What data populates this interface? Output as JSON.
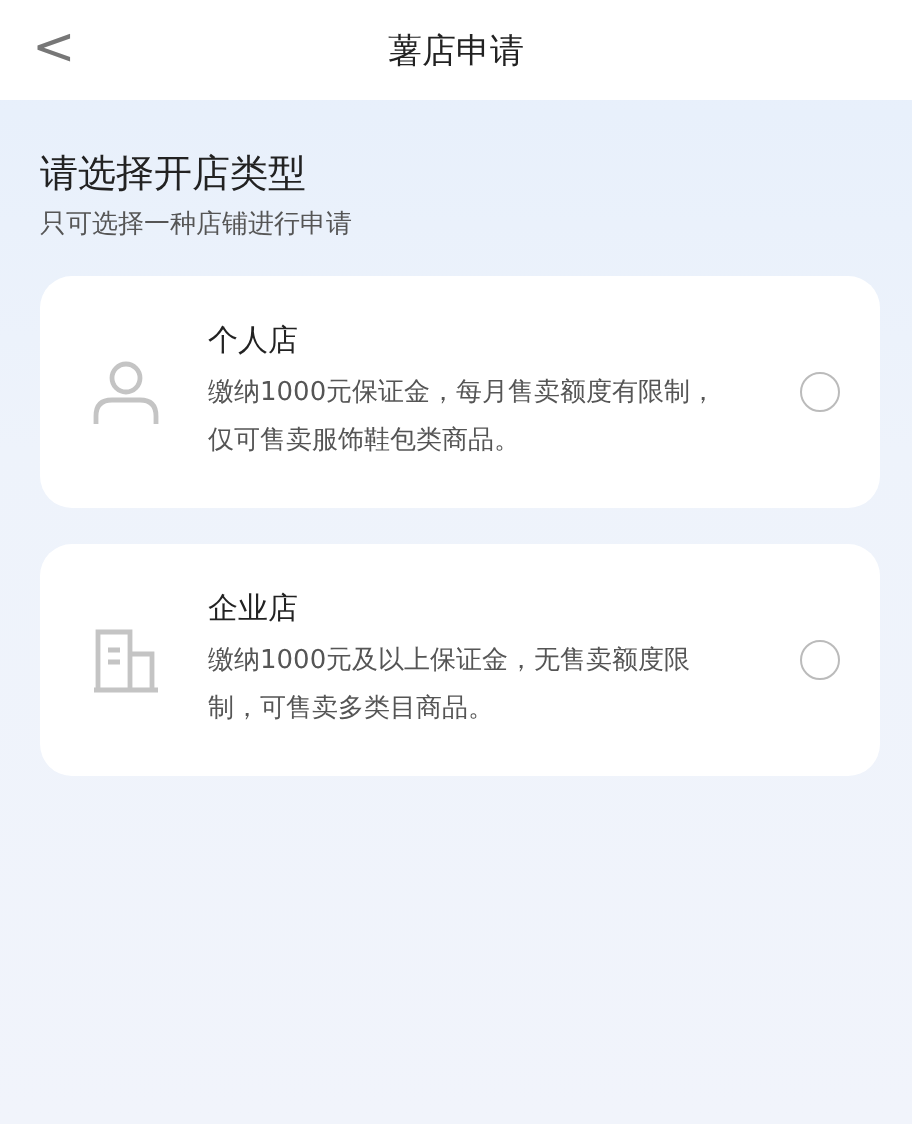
{
  "header": {
    "back": "<",
    "title": "薯店申请"
  },
  "heading": "请选择开店类型",
  "subheading": "只可选择一种店铺进行申请",
  "options": [
    {
      "kind": "person",
      "title": "个人店",
      "description": "缴纳1000元保证金，每月售卖额度有限制，仅可售卖服饰鞋包类商品。",
      "selected": false
    },
    {
      "kind": "building",
      "title": "企业店",
      "description": "缴纳1000元及以上保证金，无售卖额度限制，可售卖多类目商品。",
      "selected": false
    }
  ]
}
